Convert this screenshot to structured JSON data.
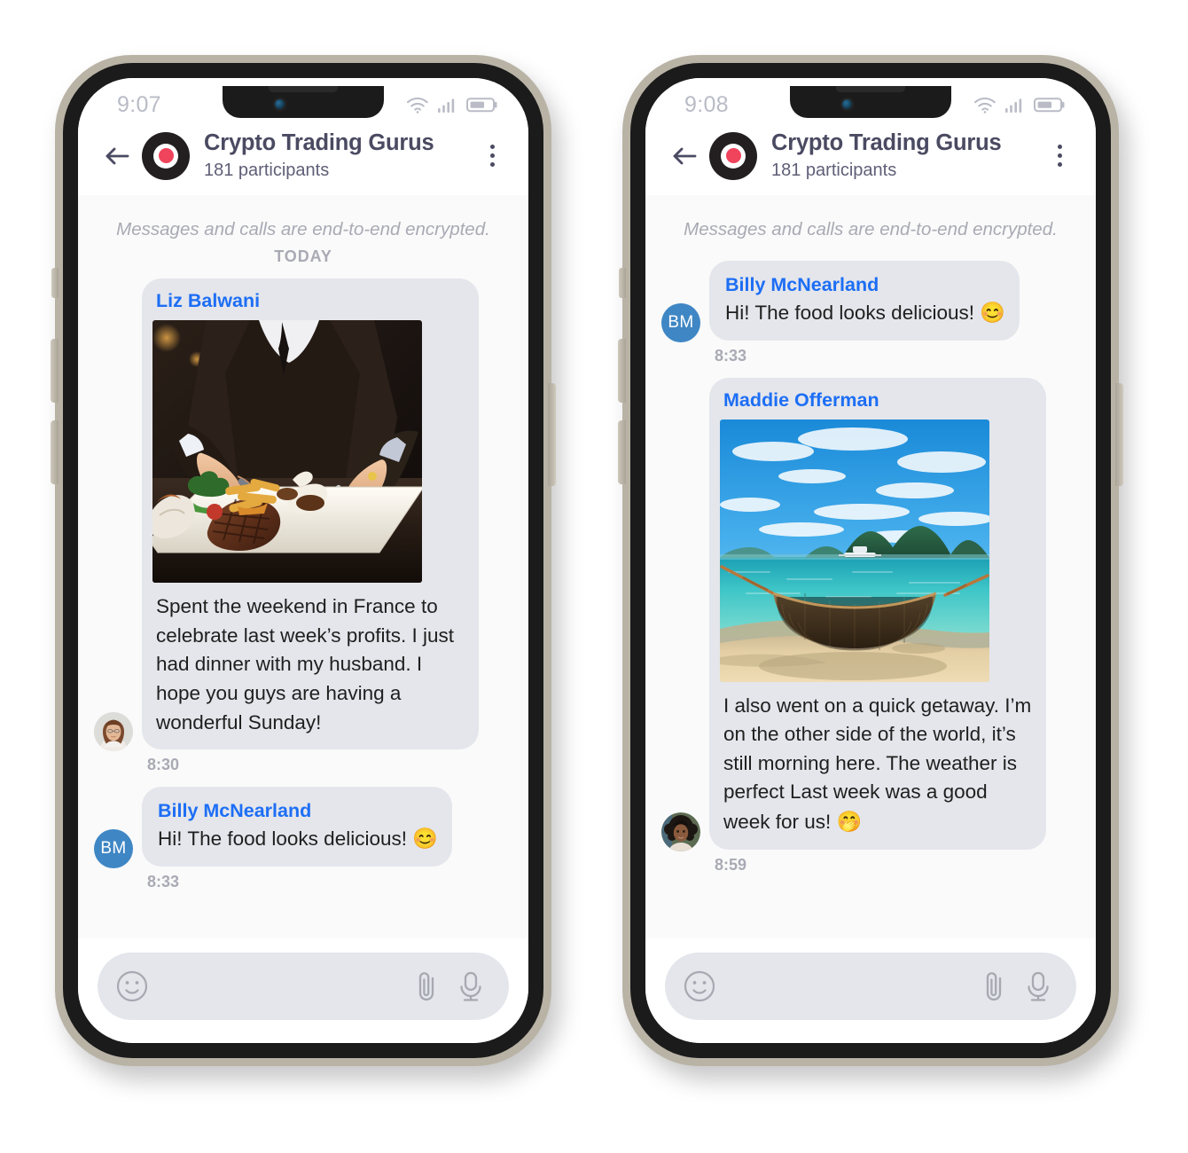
{
  "app": {
    "header": {
      "title": "Crypto Trading Gurus",
      "subtitle": "181 participants",
      "back_icon": "back-arrow-icon",
      "menu_icon": "kebab-menu-icon",
      "avatar_icon": "group-avatar-icon"
    },
    "encryption_note": "Messages and calls are end-to-end encrypted.",
    "day_separator": "TODAY",
    "composer": {
      "emoji_icon": "emoji-smiley-icon",
      "attach_icon": "paperclip-icon",
      "mic_icon": "microphone-icon",
      "placeholder": ""
    }
  },
  "phones": [
    {
      "id": "phone-left",
      "status": {
        "time": "9:07",
        "wifi_icon": "wifi-icon",
        "signal_icon": "cellular-signal-icon",
        "battery_icon": "battery-icon"
      },
      "show_encryption_note": true,
      "show_day_separator": true,
      "messages": [
        {
          "sender": "Liz Balwani",
          "avatar_type": "photo",
          "avatar_kind": "woman-glasses-avatar",
          "image": "steak-dinner-photo",
          "text": "Spent the weekend in France to celebrate last week’s profits. I just had dinner with my husband. I hope you guys are having a wonderful Sunday!",
          "time": "8:30"
        },
        {
          "sender": "Billy McNearland",
          "avatar_type": "initials",
          "avatar_initials": "BM",
          "text": "Hi! The food looks delicious!",
          "emoji": "😊",
          "time": "8:33"
        }
      ]
    },
    {
      "id": "phone-right",
      "status": {
        "time": "9:08",
        "wifi_icon": "wifi-icon",
        "signal_icon": "cellular-signal-icon",
        "battery_icon": "battery-icon"
      },
      "show_encryption_note": true,
      "show_day_separator": false,
      "messages": [
        {
          "sender": "Billy McNearland",
          "avatar_type": "initials",
          "avatar_initials": "BM",
          "text": "Hi! The food looks delicious!",
          "emoji": "😊",
          "time": "8:33"
        },
        {
          "sender": "Maddie Offerman",
          "avatar_type": "photo",
          "avatar_kind": "woman-curly-hair-avatar",
          "image": "beach-hammock-photo",
          "text": "I also went on a quick getaway. I’m on the other side of the world, it’s still morning here. The weather is perfect Last week was a good week for us!",
          "emoji": "🤭",
          "time": "8:59"
        }
      ]
    }
  ],
  "colors": {
    "sender_blue": "#1d6ef5",
    "bubble_gray": "#e4e6eb",
    "header_text": "#4a4a62",
    "muted_gray": "#a9aab4",
    "avatar_blue": "#3f86c4",
    "logo_red": "#f0435c",
    "frame_beige": "#b9b3a6",
    "frame_black": "#1b1b1b"
  }
}
